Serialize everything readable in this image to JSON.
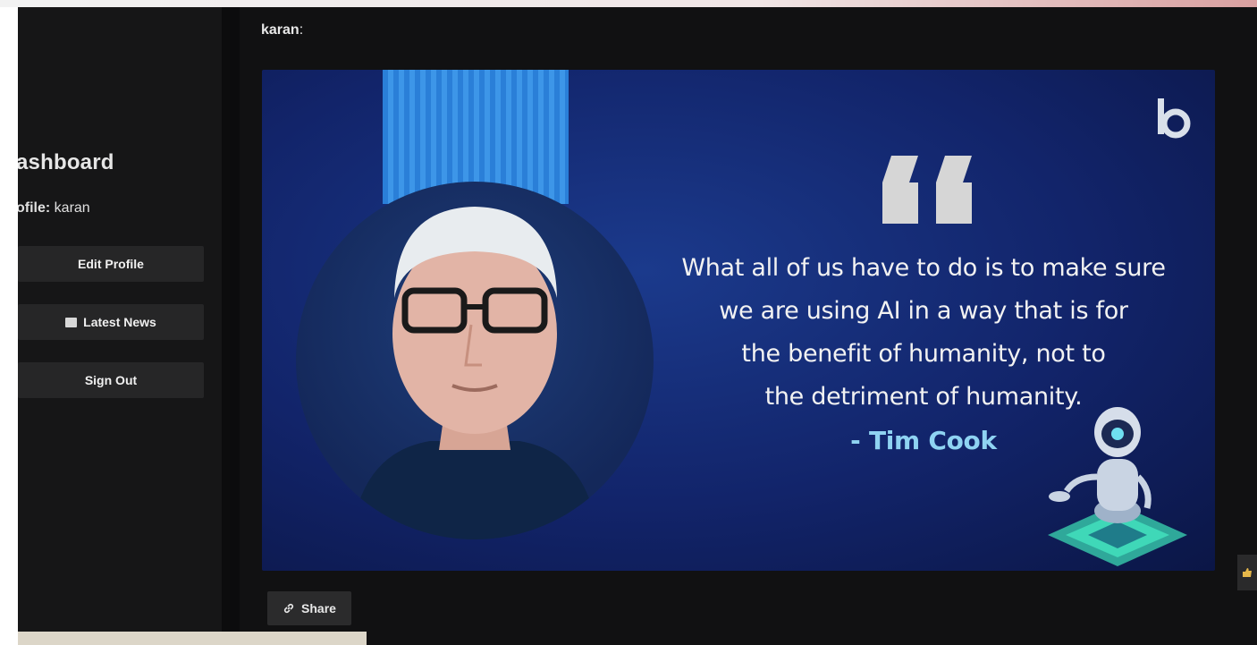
{
  "sidebar": {
    "title": "ashboard",
    "profile_label": "ofile:",
    "profile_name": "karan",
    "items": [
      {
        "label": "Edit Profile"
      },
      {
        "label": "Latest News",
        "icon": "newspaper-icon"
      },
      {
        "label": "Sign Out"
      }
    ]
  },
  "post": {
    "author": "karan",
    "author_suffix": ":",
    "image": {
      "quote": "What all of us have to do is to make sure\nwe are using AI in a way that is for\nthe benefit of humanity, not to\nthe detriment of humanity.",
      "author": "- Tim Cook",
      "quote_mark": "“",
      "brand_icon": "b-logo-icon"
    },
    "share_label": "Share",
    "like_icon": "thumbs-up-icon"
  },
  "colors": {
    "background": "#0c0c0d",
    "sidebar": "#161617",
    "button": "#262627",
    "image_blue": "#12246a",
    "author_accent": "#8fd3f2"
  }
}
